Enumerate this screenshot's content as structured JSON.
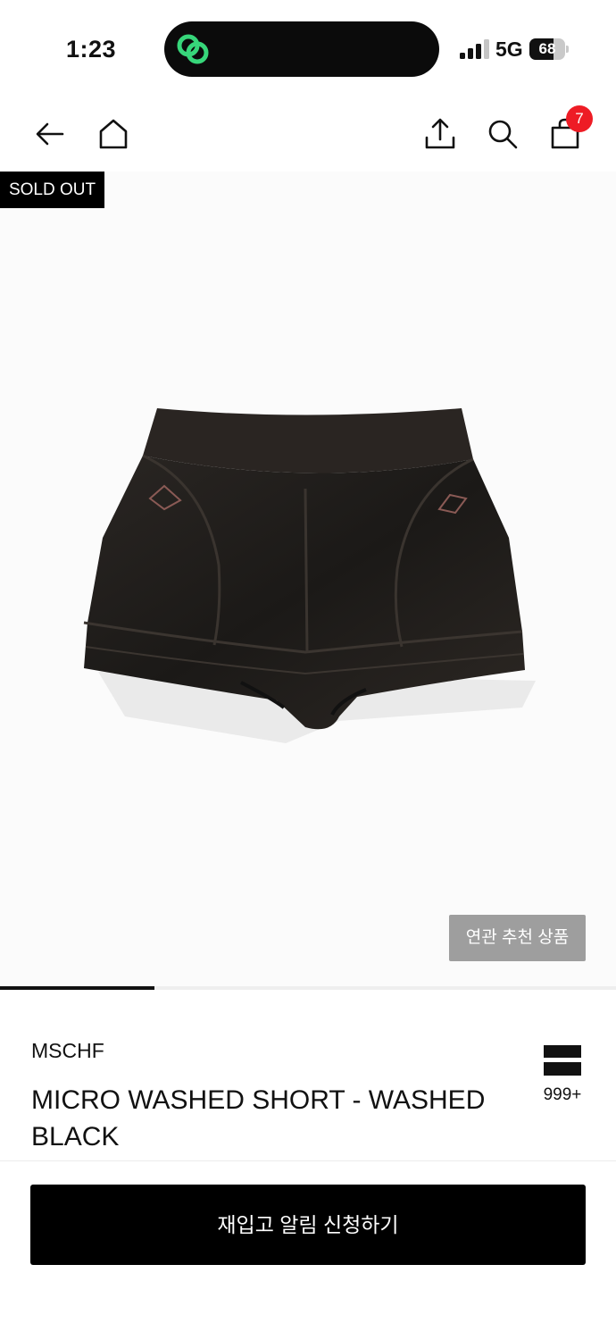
{
  "status_bar": {
    "time": "1:23",
    "network": "5G",
    "battery_level": "68",
    "battery_fraction": 0.68,
    "island_icon": "green-link-icon",
    "island_icon_color": "#37d67a"
  },
  "nav": {
    "back_icon": "arrow-left-icon",
    "home_icon": "home-icon",
    "share_icon": "share-upload-icon",
    "search_icon": "search-icon",
    "cart_icon": "shopping-bag-icon",
    "cart_count": "7",
    "cart_badge_color": "#ee1c25"
  },
  "product": {
    "sold_out_label": "SOLD OUT",
    "related_label": "연관 추천 상품",
    "gallery_progress": 0.25,
    "brand": "MSCHF",
    "name": "MICRO WASHED SHORT - WASHED BLACK",
    "like_count": "999+",
    "like_icon": "bookmark-stack-icon"
  },
  "cta": {
    "restock_label": "재입고 알림 신청하기"
  }
}
